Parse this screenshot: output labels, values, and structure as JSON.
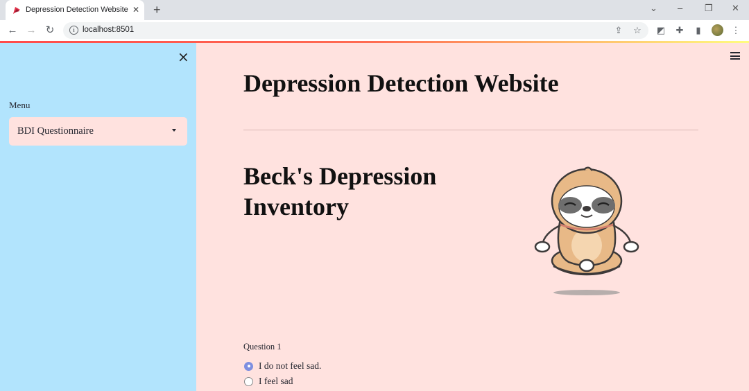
{
  "browser": {
    "tab_title": "Depression Detection Website",
    "url": "localhost:8501"
  },
  "sidebar": {
    "menu_label": "Menu",
    "select_value": "BDI Questionnaire"
  },
  "main": {
    "title": "Depression Detection Website",
    "section_title": "Beck's Depression Inventory",
    "question_label": "Question 1",
    "options": [
      {
        "label": "I do not feel sad.",
        "selected": true
      },
      {
        "label": "I feel sad",
        "selected": false
      }
    ]
  },
  "colors": {
    "sidebar_bg": "#b2e4fd",
    "main_bg": "#ffe2df",
    "radio_accent": "#7e8fe0"
  },
  "icons": [
    "favicon-icon",
    "close-icon",
    "new-tab-icon",
    "back-icon",
    "forward-icon",
    "reload-icon",
    "info-icon",
    "share-icon",
    "star-icon",
    "extension-icon",
    "puzzle-icon",
    "side-panel-icon",
    "menu-dots-icon",
    "hamburger-icon",
    "sloth-illustration"
  ]
}
